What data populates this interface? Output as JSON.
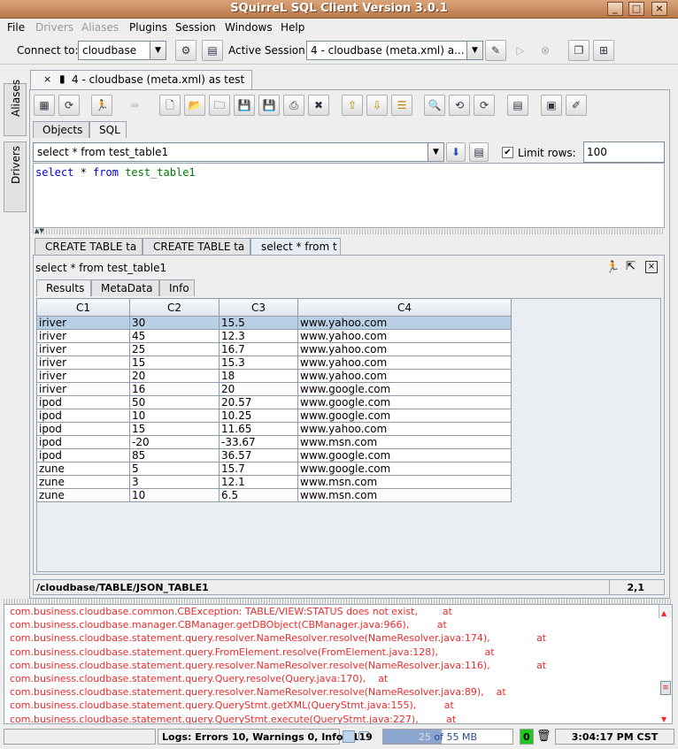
{
  "window": {
    "title": "SQuirreL SQL Client Version 3.0.1"
  },
  "menu": [
    "File",
    "Drivers",
    "Aliases",
    "Plugins",
    "Session",
    "Windows",
    "Help"
  ],
  "connect": {
    "label": "Connect to:",
    "value": "cloudbase",
    "active_label": "Active Session:",
    "active_value": "4 - cloudbase (meta.xml) a..."
  },
  "sidebar": {
    "aliases": "Aliases",
    "drivers": "Drivers"
  },
  "session_tab": "4 - cloudbase (meta.xml) as test",
  "obj_tabs": [
    "Objects",
    "SQL"
  ],
  "sql": {
    "history_value": "select * from test_table1",
    "limit_label": "Limit rows:",
    "limit_value": "100",
    "editor_kw1": "select",
    "editor_star": " * ",
    "editor_kw2": "from",
    "editor_table": "test_table1"
  },
  "result_tabs": [
    "CREATE TABLE ta",
    "CREATE TABLE ta",
    "select * from t"
  ],
  "result": {
    "query": "select * from test_table1",
    "tabs": [
      "Results",
      "MetaData",
      "Info"
    ],
    "columns": [
      "C1",
      "C2",
      "C3",
      "C4"
    ],
    "rows": [
      [
        "iriver",
        "30",
        "15.5",
        "www.yahoo.com"
      ],
      [
        "iriver",
        "45",
        "12.3",
        "www.yahoo.com"
      ],
      [
        "iriver",
        "25",
        "16.7",
        "www.yahoo.com"
      ],
      [
        "iriver",
        "15",
        "15.3",
        "www.yahoo.com"
      ],
      [
        "iriver",
        "20",
        "18",
        "www.yahoo.com"
      ],
      [
        "iriver",
        "16",
        "20",
        "www.google.com"
      ],
      [
        "ipod",
        "50",
        "20.57",
        "www.google.com"
      ],
      [
        "ipod",
        "10",
        "10.25",
        "www.google.com"
      ],
      [
        "ipod",
        "15",
        "11.65",
        "www.yahoo.com"
      ],
      [
        "ipod",
        "-20",
        "-33.67",
        "www.msn.com"
      ],
      [
        "ipod",
        "85",
        "36.57",
        "www.google.com"
      ],
      [
        "zune",
        "5",
        "15.7",
        "www.google.com"
      ],
      [
        "zune",
        "3",
        "12.1",
        "www.msn.com"
      ],
      [
        "zune",
        "10",
        "6.5",
        "www.msn.com"
      ]
    ]
  },
  "status": {
    "path": "/cloudbase/TABLE/JSON_TABLE1",
    "position": "2,1"
  },
  "log": [
    "com.business.cloudbase.common.CBException: TABLE/VIEW:STATUS does not exist,        at",
    "com.business.cloudbase.manager.CBManager.getDBObject(CBManager.java:966),         at",
    "com.business.cloudbase.statement.query.resolver.NameResolver.resolve(NameResolver.java:174),               at",
    "com.business.cloudbase.statement.query.FromElement.resolve(FromElement.java:128),               at",
    "com.business.cloudbase.statement.query.resolver.NameResolver.resolve(NameResolver.java:116),               at",
    "com.business.cloudbase.statement.query.Query.resolve(Query.java:170),    at",
    "com.business.cloudbase.statement.query.resolver.NameResolver.resolve(NameResolver.java:89),    at",
    "com.business.cloudbase.statement.query.QueryStmt.getXML(QueryStmt.java:155),         at",
    "com.business.cloudbase.statement.query.QueryStmt.execute(QueryStmt.java:227),         at"
  ],
  "bottom": {
    "logs": "Logs: Errors 10, Warnings 0, Infos 119",
    "mem_used": "25",
    "mem_of": " of ",
    "mem_total": "55 MB",
    "gc_count": "0",
    "time": "3:04:17 PM CST"
  }
}
